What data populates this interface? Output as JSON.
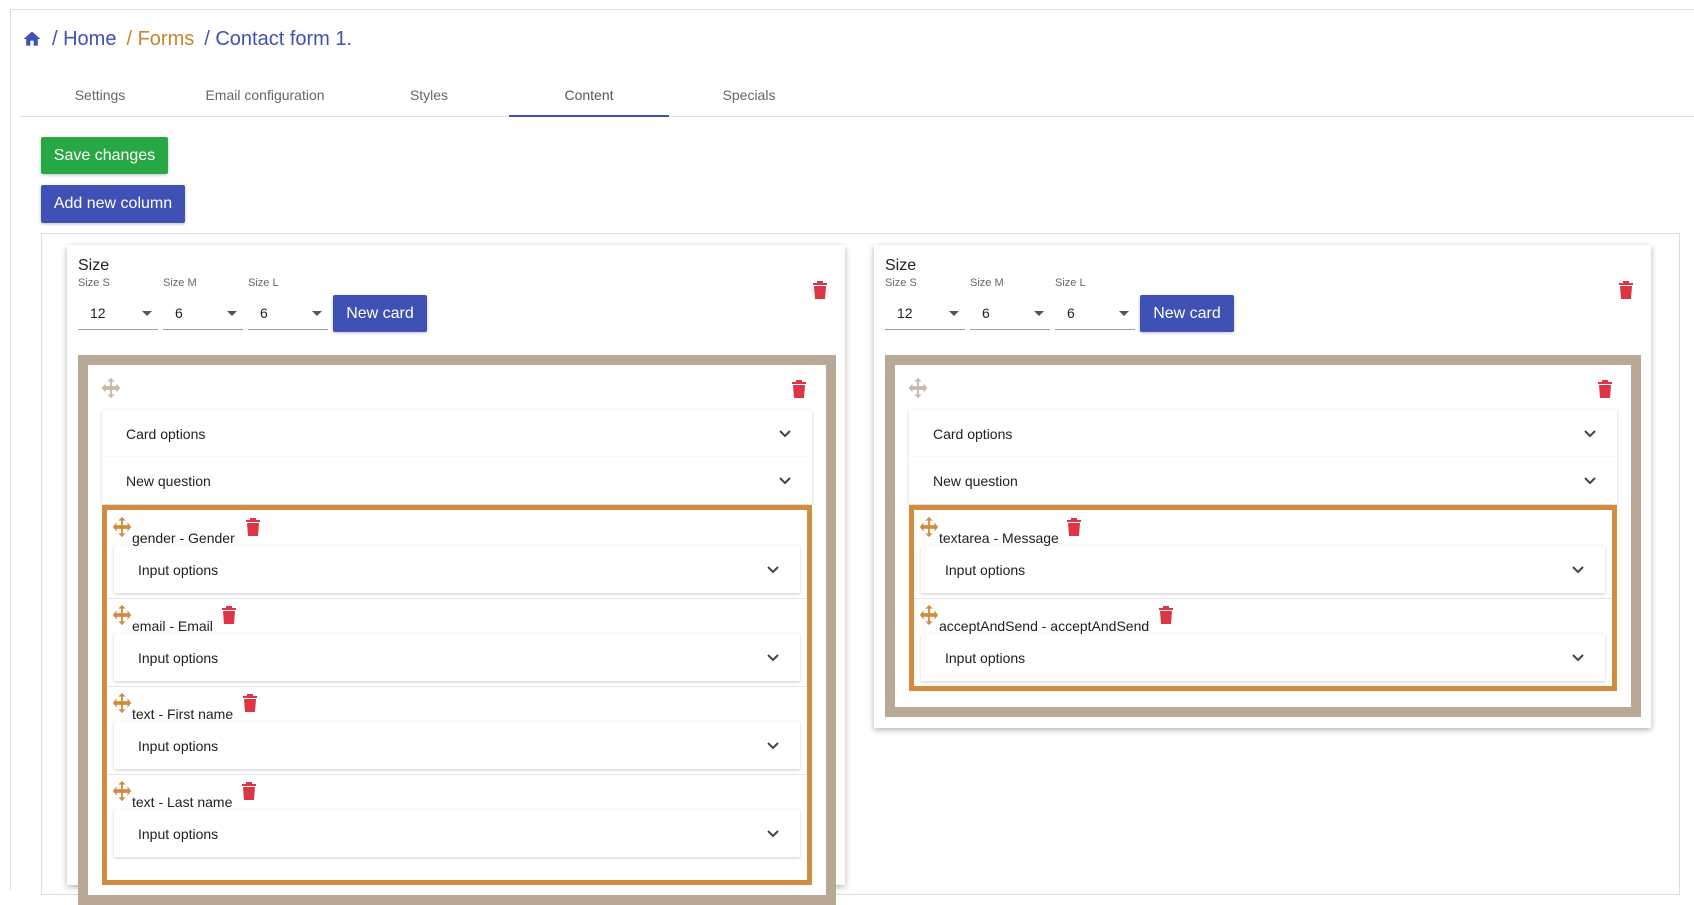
{
  "breadcrumb": {
    "home": "/ Home",
    "forms": "/ Forms",
    "current": "/ Contact form 1."
  },
  "tabs": [
    {
      "label": "Settings"
    },
    {
      "label": "Email configuration"
    },
    {
      "label": "Styles"
    },
    {
      "label": "Content",
      "active": true
    },
    {
      "label": "Specials"
    }
  ],
  "actions": {
    "save_label": "Save changes",
    "add_column_label": "Add new column"
  },
  "columns": [
    {
      "size_title": "Size",
      "size_s_label": "Size S",
      "size_m_label": "Size M",
      "size_l_label": "Size L",
      "size_s": "12",
      "size_m": "6",
      "size_l": "6",
      "new_card_label": "New card",
      "card": {
        "card_options_label": "Card options",
        "new_question_label": "New question",
        "questions": [
          {
            "title": "gender - Gender",
            "options_label": "Input options"
          },
          {
            "title": "email - Email",
            "options_label": "Input options"
          },
          {
            "title": "text - First name",
            "options_label": "Input options"
          },
          {
            "title": "text - Last name",
            "options_label": "Input options"
          }
        ]
      }
    },
    {
      "size_title": "Size",
      "size_s_label": "Size S",
      "size_m_label": "Size M",
      "size_l_label": "Size L",
      "size_s": "12",
      "size_m": "6",
      "size_l": "6",
      "new_card_label": "New card",
      "card": {
        "card_options_label": "Card options",
        "new_question_label": "New question",
        "questions": [
          {
            "title": "textarea - Message",
            "options_label": "Input options"
          },
          {
            "title": "acceptAndSend - acceptAndSend",
            "options_label": "Input options"
          }
        ]
      }
    }
  ],
  "icons": {
    "home": "home-icon",
    "delete": "trash-icon",
    "move": "move-icon",
    "expand": "chevron-down-icon"
  },
  "colors": {
    "primary": "#3f51b5",
    "success": "#28a745",
    "danger": "#dc3545",
    "card_border": "#b8a896",
    "question_border": "#d18d3f",
    "forms_crumb": "#c6862a"
  }
}
